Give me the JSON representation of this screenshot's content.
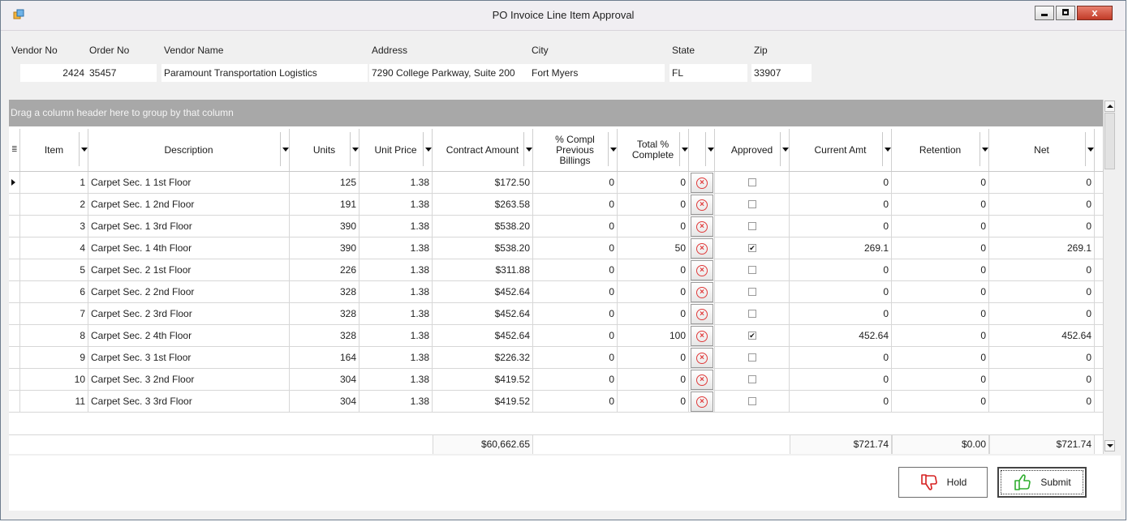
{
  "window": {
    "title": "PO Invoice Line Item Approval",
    "minimize_label": "",
    "close_label": "x"
  },
  "header": {
    "labels": {
      "vendor_no": "Vendor No",
      "order_no": "Order No",
      "vendor_name": "Vendor Name",
      "address": "Address",
      "city": "City",
      "state": "State",
      "zip": "Zip"
    },
    "values": {
      "vendor_no": "2424",
      "order_no": "35457",
      "vendor_name": "Paramount Transportation Logistics",
      "address": "7290 College Parkway, Suite 200",
      "city": "Fort Myers",
      "state": "FL",
      "zip": "33907"
    }
  },
  "grid": {
    "group_panel_text": "Drag a column header here to group by that column",
    "columns": {
      "item": "Item",
      "description": "Description",
      "units": "Units",
      "unit_price": "Unit Price",
      "contract_amount": "Contract Amount",
      "prev_billings": "% Compl Previous Billings",
      "total_complete": "Total % Complete",
      "reject": "",
      "approved": "Approved",
      "current_amt": "Current Amt",
      "retention": "Retention",
      "net": "Net"
    },
    "rows": [
      {
        "item": "1",
        "description": "Carpet Sec. 1 1st Floor",
        "units": "125",
        "unit_price": "1.38",
        "contract_amount": "$172.50",
        "prev": "0",
        "total": "0",
        "approved": false,
        "current": "0",
        "retention": "0",
        "net": "0"
      },
      {
        "item": "2",
        "description": "Carpet Sec. 1 2nd Floor",
        "units": "191",
        "unit_price": "1.38",
        "contract_amount": "$263.58",
        "prev": "0",
        "total": "0",
        "approved": false,
        "current": "0",
        "retention": "0",
        "net": "0"
      },
      {
        "item": "3",
        "description": "Carpet Sec. 1 3rd Floor",
        "units": "390",
        "unit_price": "1.38",
        "contract_amount": "$538.20",
        "prev": "0",
        "total": "0",
        "approved": false,
        "current": "0",
        "retention": "0",
        "net": "0"
      },
      {
        "item": "4",
        "description": "Carpet Sec. 1 4th Floor",
        "units": "390",
        "unit_price": "1.38",
        "contract_amount": "$538.20",
        "prev": "0",
        "total": "50",
        "approved": true,
        "current": "269.1",
        "retention": "0",
        "net": "269.1"
      },
      {
        "item": "5",
        "description": "Carpet Sec. 2 1st Floor",
        "units": "226",
        "unit_price": "1.38",
        "contract_amount": "$311.88",
        "prev": "0",
        "total": "0",
        "approved": false,
        "current": "0",
        "retention": "0",
        "net": "0"
      },
      {
        "item": "6",
        "description": "Carpet Sec. 2 2nd Floor",
        "units": "328",
        "unit_price": "1.38",
        "contract_amount": "$452.64",
        "prev": "0",
        "total": "0",
        "approved": false,
        "current": "0",
        "retention": "0",
        "net": "0"
      },
      {
        "item": "7",
        "description": "Carpet Sec. 2 3rd Floor",
        "units": "328",
        "unit_price": "1.38",
        "contract_amount": "$452.64",
        "prev": "0",
        "total": "0",
        "approved": false,
        "current": "0",
        "retention": "0",
        "net": "0"
      },
      {
        "item": "8",
        "description": "Carpet Sec. 2 4th Floor",
        "units": "328",
        "unit_price": "1.38",
        "contract_amount": "$452.64",
        "prev": "0",
        "total": "100",
        "approved": true,
        "current": "452.64",
        "retention": "0",
        "net": "452.64"
      },
      {
        "item": "9",
        "description": "Carpet Sec. 3 1st Floor",
        "units": "164",
        "unit_price": "1.38",
        "contract_amount": "$226.32",
        "prev": "0",
        "total": "0",
        "approved": false,
        "current": "0",
        "retention": "0",
        "net": "0"
      },
      {
        "item": "10",
        "description": "Carpet Sec. 3 2nd Floor",
        "units": "304",
        "unit_price": "1.38",
        "contract_amount": "$419.52",
        "prev": "0",
        "total": "0",
        "approved": false,
        "current": "0",
        "retention": "0",
        "net": "0"
      },
      {
        "item": "11",
        "description": "Carpet Sec. 3 3rd Floor",
        "units": "304",
        "unit_price": "1.38",
        "contract_amount": "$419.52",
        "prev": "0",
        "total": "0",
        "approved": false,
        "current": "0",
        "retention": "0",
        "net": "0"
      }
    ],
    "totals": {
      "contract_amount": "$60,662.65",
      "current_amt": "$721.74",
      "retention": "$0.00",
      "net": "$721.74"
    },
    "reject_icon": "x-circle-icon",
    "check_mark": "✔"
  },
  "actions": {
    "hold_label": "Hold",
    "submit_label": "Submit",
    "hold_icon": "thumbs-down-icon",
    "submit_icon": "thumbs-up-icon",
    "hold_color": "#d62020",
    "submit_color": "#2fae2f"
  }
}
